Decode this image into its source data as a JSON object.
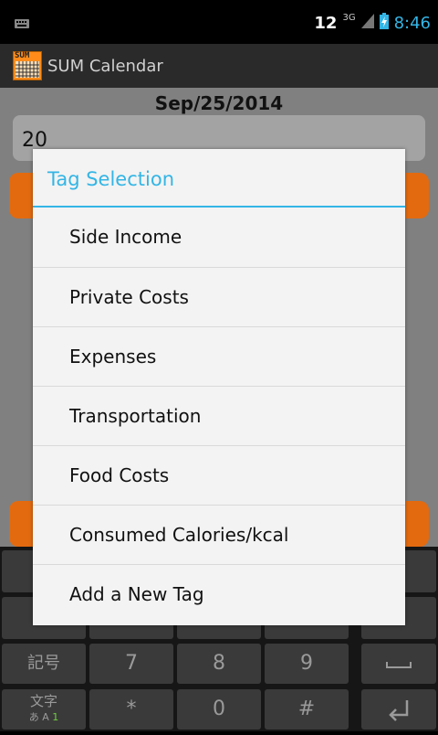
{
  "statusbar": {
    "notification_count": "12",
    "network_type": "3G",
    "time": "8:46"
  },
  "actionbar": {
    "app_icon_text": "SUM",
    "title": "SUM Calendar"
  },
  "main": {
    "date": "Sep/25/2014",
    "amount_value": "20"
  },
  "dialog": {
    "title": "Tag Selection",
    "items": [
      {
        "label": "Side Income"
      },
      {
        "label": "Private Costs"
      },
      {
        "label": "Expenses"
      },
      {
        "label": "Transportation"
      },
      {
        "label": "Food Costs"
      },
      {
        "label": "Consumed Calories/kcal"
      },
      {
        "label": "Add a New Tag"
      }
    ]
  },
  "keyboard": {
    "symbols_key": "記号",
    "row3": [
      "7",
      "8",
      "9"
    ],
    "row4": [
      "*",
      "0",
      "#"
    ],
    "mode_key_main": "文字",
    "mode_key_sub_kana": "あ",
    "mode_key_sub_alpha": "A",
    "mode_key_sub_num": "1"
  },
  "colors": {
    "accent": "#33b5e5",
    "orange": "#e36a0f",
    "dialog_bg": "#f3f3f3"
  }
}
